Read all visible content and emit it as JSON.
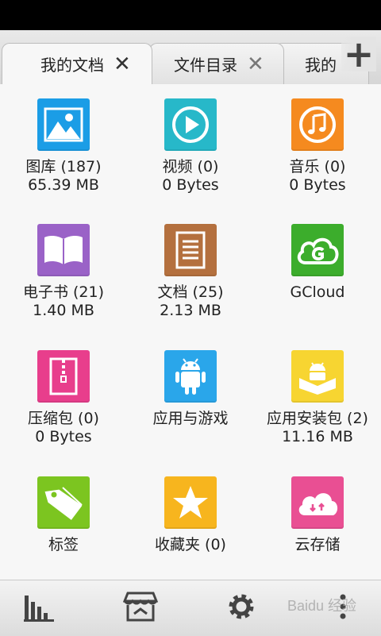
{
  "tabs": [
    {
      "label": "我的文档",
      "close": "✕"
    },
    {
      "label": "文件目录",
      "close": "✕"
    },
    {
      "label": "我的"
    }
  ],
  "add_tab": "+",
  "items": [
    {
      "name": "图库 (187)",
      "size": "65.39 MB",
      "icon": "gallery-icon",
      "color": "#1b9de6"
    },
    {
      "name": "视频 (0)",
      "size": "0 Bytes",
      "icon": "video-play-icon",
      "color": "#27b8c9"
    },
    {
      "name": "音乐 (0)",
      "size": "0 Bytes",
      "icon": "music-note-icon",
      "color": "#f58a1f"
    },
    {
      "name": "电子书 (21)",
      "size": "1.40 MB",
      "icon": "book-icon",
      "color": "#9a62c7"
    },
    {
      "name": "文档 (25)",
      "size": "2.13 MB",
      "icon": "document-icon",
      "color": "#b4703e"
    },
    {
      "name": "GCloud",
      "size": "",
      "icon": "gcloud-icon",
      "color": "#3cad2c"
    },
    {
      "name": "压缩包 (0)",
      "size": "0 Bytes",
      "icon": "zip-icon",
      "color": "#e83e8c"
    },
    {
      "name": "应用与游戏",
      "size": "",
      "icon": "android-icon",
      "color": "#2aa6ea"
    },
    {
      "name": "应用安装包 (2)",
      "size": "11.16 MB",
      "icon": "apk-box-icon",
      "color": "#f7d531"
    },
    {
      "name": "标签",
      "size": "",
      "icon": "tag-icon",
      "color": "#7cc520"
    },
    {
      "name": "收藏夹 (0)",
      "size": "",
      "icon": "star-icon",
      "color": "#f7b51e"
    },
    {
      "name": "云存储",
      "size": "",
      "icon": "cloud-storage-icon",
      "color": "#e94f93"
    }
  ],
  "bottom_nav": [
    {
      "icon": "chart-icon"
    },
    {
      "icon": "store-icon"
    },
    {
      "icon": "gear-icon"
    },
    {
      "icon": "more-icon"
    }
  ],
  "watermark": "Baidu 经验"
}
